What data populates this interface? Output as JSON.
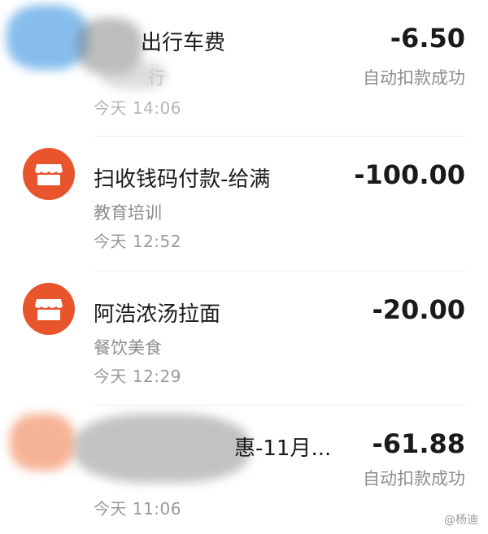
{
  "transactions": [
    {
      "title": "出行车费",
      "subtitle": "行",
      "time": "今天  14:06",
      "amount": "-6.50",
      "status": "自动扣款成功"
    },
    {
      "title": "扫收钱码付款-给满",
      "category": "教育培训",
      "time": "今天  12:52",
      "amount": "-100.00",
      "icon": "storefront-icon"
    },
    {
      "title": "阿浩浓汤拉面",
      "category": "餐饮美食",
      "time": "今天  12:29",
      "amount": "-20.00",
      "icon": "storefront-icon"
    },
    {
      "title": "惠-11月...",
      "time": "今天  11:06",
      "amount": "-61.88",
      "status": "自动扣款成功"
    }
  ],
  "watermark": "@杨迪",
  "colors": {
    "accent": "#e8542b",
    "text_primary": "#1a1a1a",
    "text_secondary": "#8e8e8e"
  }
}
